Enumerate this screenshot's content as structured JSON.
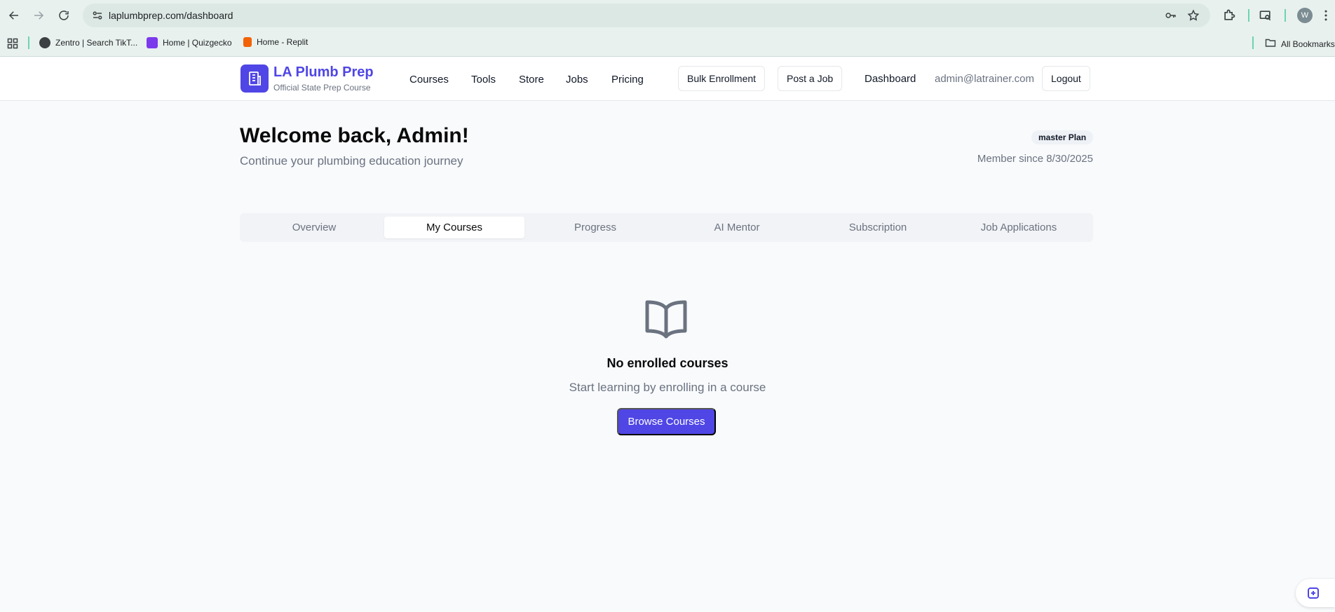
{
  "browser": {
    "url": "laplumbprep.com/dashboard",
    "profile_initial": "W",
    "bookmarks": [
      {
        "label": "Zentro | Search TikT..."
      },
      {
        "label": "Home | Quizgecko"
      },
      {
        "label": "Home - Replit"
      }
    ],
    "all_bookmarks": "All Bookmarks"
  },
  "header": {
    "brand_name": "LA Plumb Prep",
    "brand_tagline": "Official State Prep Course",
    "nav": [
      "Courses",
      "Tools",
      "Store",
      "Jobs",
      "Pricing"
    ],
    "bulk_enrollment": "Bulk Enrollment",
    "post_job": "Post a Job",
    "dashboard": "Dashboard",
    "email": "admin@latrainer.com",
    "logout": "Logout"
  },
  "welcome": {
    "title": "Welcome back, Admin!",
    "subtitle": "Continue your plumbing education journey",
    "plan_badge": "master Plan",
    "member_since": "Member since 8/30/2025"
  },
  "tabs": [
    {
      "label": "Overview",
      "active": false
    },
    {
      "label": "My Courses",
      "active": true
    },
    {
      "label": "Progress",
      "active": false
    },
    {
      "label": "AI Mentor",
      "active": false
    },
    {
      "label": "Subscription",
      "active": false
    },
    {
      "label": "Job Applications",
      "active": false
    }
  ],
  "empty_state": {
    "icon": "open-book-icon",
    "title": "No enrolled courses",
    "subtitle": "Start learning by enrolling in a course",
    "button": "Browse Courses"
  },
  "colors": {
    "primary": "#4f46e5",
    "muted_text": "#6b7280",
    "page_bg": "#f8fafc"
  }
}
